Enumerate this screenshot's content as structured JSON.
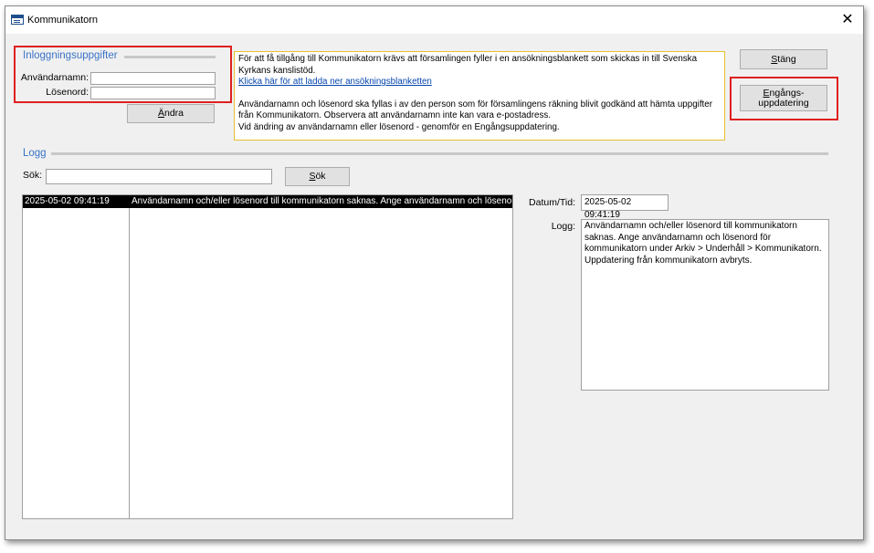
{
  "window": {
    "title": "Kommunikatorn",
    "close_glyph": "✕"
  },
  "login": {
    "group_title": "Inloggningsuppgifter",
    "username_label": "Användarnamn:",
    "username_value": "",
    "password_label": "Lösenord:",
    "password_value": "",
    "change_button_first": "Ä",
    "change_button_rest": "ndra"
  },
  "info": {
    "line1": "För att få tillgång till Kommunikatorn krävs att församlingen fyller i en ansökningsblankett som skickas in till Svenska Kyrkans kanslistöd.",
    "link": "Klicka här för att ladda ner ansökningsblanketten",
    "line2": "Användarnamn och lösenord ska fyllas i av den person som för församlingens räkning blivit godkänd att hämta uppgifter från Kommunikatorn. Observera att användarnamn inte kan vara e-postadress.",
    "line3": "Vid ändring av användarnamn eller lösenord - genomför en Engångsuppdatering."
  },
  "buttons": {
    "close_first": "S",
    "close_rest": "täng",
    "onetime_first": "E",
    "onetime_line1_rest": "ngångs-",
    "onetime_line2": "uppdatering"
  },
  "log": {
    "group_title": "Logg",
    "search_label": "Sök:",
    "search_value": "",
    "search_button_first": "S",
    "search_button_rest": "ök",
    "rows": [
      {
        "datetime": "2025-05-02 09:41:19",
        "message": "Användarnamn och/eller lösenord till kommunikatorn saknas. Ange användarnamn och lösenord för kommunikatorn under Arkiv > Underhåll > Kommunikatorn. Uppdatering från kommunikatorn avbryts."
      }
    ],
    "detail_datetime_label": "Datum/Tid:",
    "detail_datetime_value": "2025-05-02 09:41:19",
    "detail_log_label": "Logg:",
    "detail_log_value": "Användarnamn och/eller lösenord till kommunikatorn saknas. Ange användarnamn och lösenord för kommunikatorn under Arkiv > Underhåll > Kommunikatorn. Uppdatering från kommunikatorn avbryts."
  },
  "colors": {
    "highlight": "#e02020",
    "group_title": "#3a73c7",
    "info_border": "#e8c030",
    "selected_row": "#000000"
  }
}
